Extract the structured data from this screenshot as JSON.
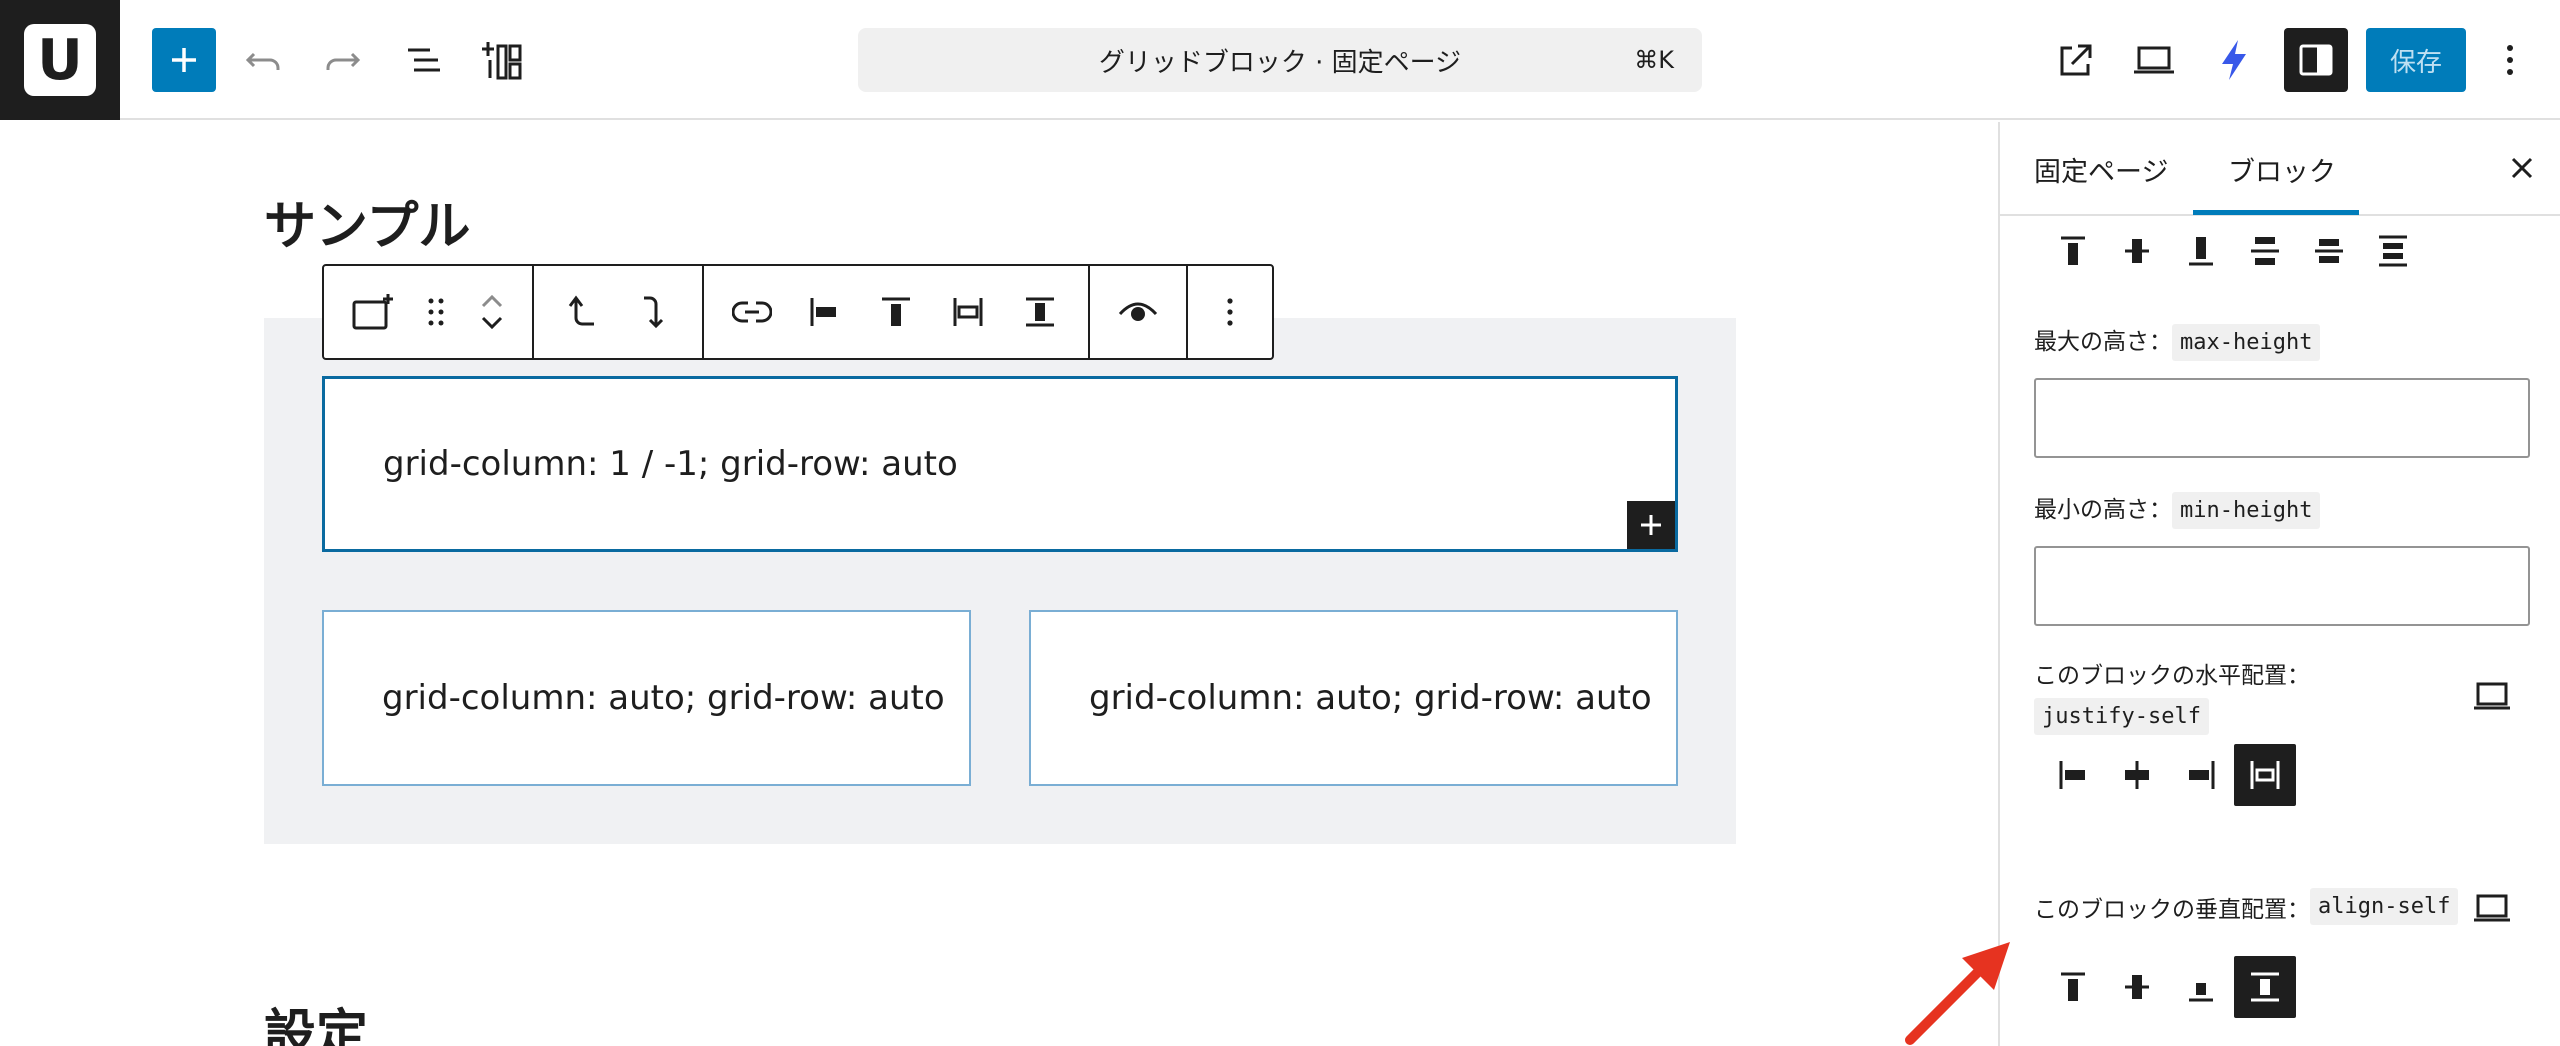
{
  "topbar": {
    "logo_letter": "U",
    "document_title": "グリッドブロック · 固定ページ",
    "shortcut": "⌘K",
    "save_label": "保存",
    "icons": [
      "plus-icon",
      "undo-icon",
      "redo-icon",
      "document-overview-icon",
      "block-patterns-icon",
      "external-link-icon",
      "device-preview-icon",
      "lightning-icon",
      "sidebar-settings-icon",
      "more-vertical-icon"
    ]
  },
  "canvas": {
    "heading_sample": "サンプル",
    "heading_settings": "設定",
    "cells": [
      "grid-column: 1 / -1; grid-row: auto",
      "grid-column: auto; grid-row: auto",
      "grid-column: auto; grid-row: auto"
    ]
  },
  "sidebar": {
    "tab_page": "固定ページ",
    "tab_block": "ブロック",
    "max_height_label": "最大の高さ：",
    "max_height_code": "max-height",
    "max_height_value": "",
    "min_height_label": "最小の高さ：",
    "min_height_code": "min-height",
    "min_height_value": "",
    "justify_label": "このブロックの水平配置：",
    "justify_code": "justify-self",
    "align_label": "このブロックの垂直配置：",
    "align_code": "align-self"
  },
  "colors": {
    "accent": "#007cba",
    "dark": "#1e1e1e",
    "arrow": "#e63320",
    "lightning": "#3858e9"
  }
}
